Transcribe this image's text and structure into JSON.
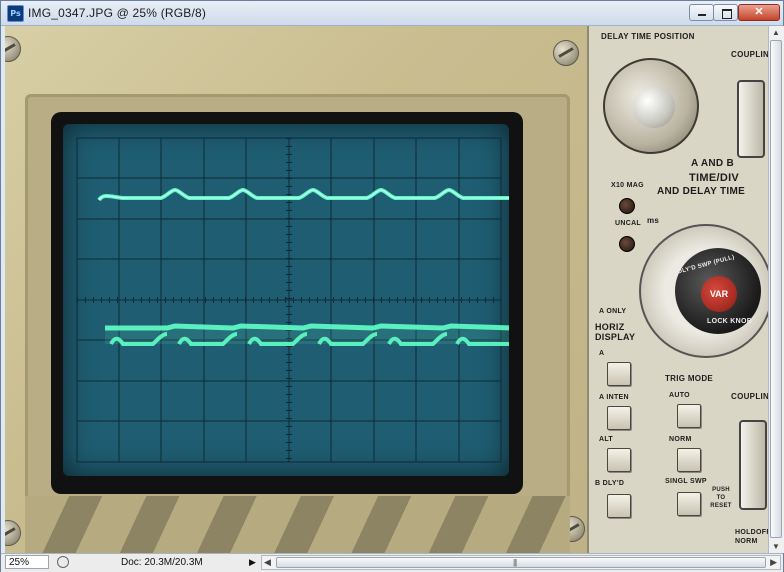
{
  "window": {
    "app_icon_label": "Ps",
    "title": "IMG_0347.JPG @ 25% (RGB/8)",
    "controls": {
      "minimize": "minimize-icon",
      "maximize": "maximize-icon",
      "close": "close-icon",
      "close_glyph": "✕"
    }
  },
  "photo": {
    "subject": "oscilloscope",
    "panel_labels": {
      "delay_time_position": "DELAY TIME POSITION",
      "coupling_top": "COUPLING",
      "a_and_b": "A AND B",
      "time_div": "TIME/DIV",
      "and_delay_time": "AND DELAY TIME",
      "x10_mag": "X10 MAG",
      "uncal": "UNCAL",
      "ms": "ms",
      "dlyd_swp_pull": "DLY'D SWP (PULL)",
      "var": "VAR",
      "lock_knob": "LOCK KNOB",
      "a_only": "A ONLY",
      "horiz_display": "HORIZ DISPLAY",
      "btn_a": "A",
      "btn_a_inten": "A INTEN",
      "btn_alt": "ALT",
      "btn_b_dlyd": "B DLY'D",
      "trig_mode": "TRIG MODE",
      "btn_auto": "AUTO",
      "btn_norm": "NORM",
      "btn_singl_swp": "SINGL SWP",
      "push_to_reset": "PUSH TO RESET",
      "coupling_bottom": "COUPLING",
      "holdoff_norm": "HOLDOFF NORM"
    }
  },
  "statusbar": {
    "zoom": "25%",
    "doc_info": "Doc: 20.3M/20.3M",
    "arrow": "▶",
    "scroll_left": "◀",
    "scroll_right": "▶",
    "grip": "|||"
  },
  "vscrollbar": {
    "up": "▲",
    "down": "▼"
  },
  "colors": {
    "trace": "#5fffc6",
    "crt_bg": "#1f5d72",
    "grid": "#0e2a34"
  }
}
